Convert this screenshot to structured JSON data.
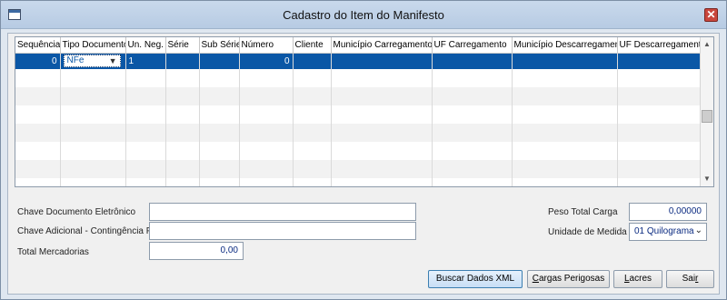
{
  "window": {
    "title": "Cadastro do Item do Manifesto",
    "close": "✕"
  },
  "grid": {
    "columns": [
      "Sequência",
      "Tipo Documento",
      "Un. Neg.",
      "Série",
      "Sub Série",
      "Número",
      "Cliente",
      "Município Carregamento",
      "UF Carregamento",
      "Município Descarregamento",
      "UF Descarregamento"
    ],
    "rows": [
      {
        "sequencia": "0",
        "tipo_documento": "NFe",
        "un_neg": "1",
        "serie": "",
        "sub_serie": "",
        "numero": "0",
        "cliente": "",
        "municipio_carregamento": "",
        "uf_carregamento": "",
        "municipio_descarregamento": "",
        "uf_descarregamento": ""
      }
    ]
  },
  "form": {
    "chave_documento_label": "Chave Documento Eletrônico",
    "chave_documento_value": "",
    "chave_adicional_label": "Chave Adicional - Contingência FS",
    "chave_adicional_value": "",
    "total_mercadorias_label": "Total Mercadorias",
    "total_mercadorias_value": "0,00",
    "peso_total_label": "Peso Total Carga",
    "peso_total_value": "0,00000",
    "unidade_medida_label": "Unidade de Medida",
    "unidade_medida_value": "01 Quilograma"
  },
  "buttons": {
    "buscar": "Buscar Dados XML",
    "cargas_first": "C",
    "cargas_rest": "argas Perigosas",
    "lacres_first": "L",
    "lacres_rest": "acres",
    "sair_first": "Sai",
    "sair_rest": "r"
  }
}
